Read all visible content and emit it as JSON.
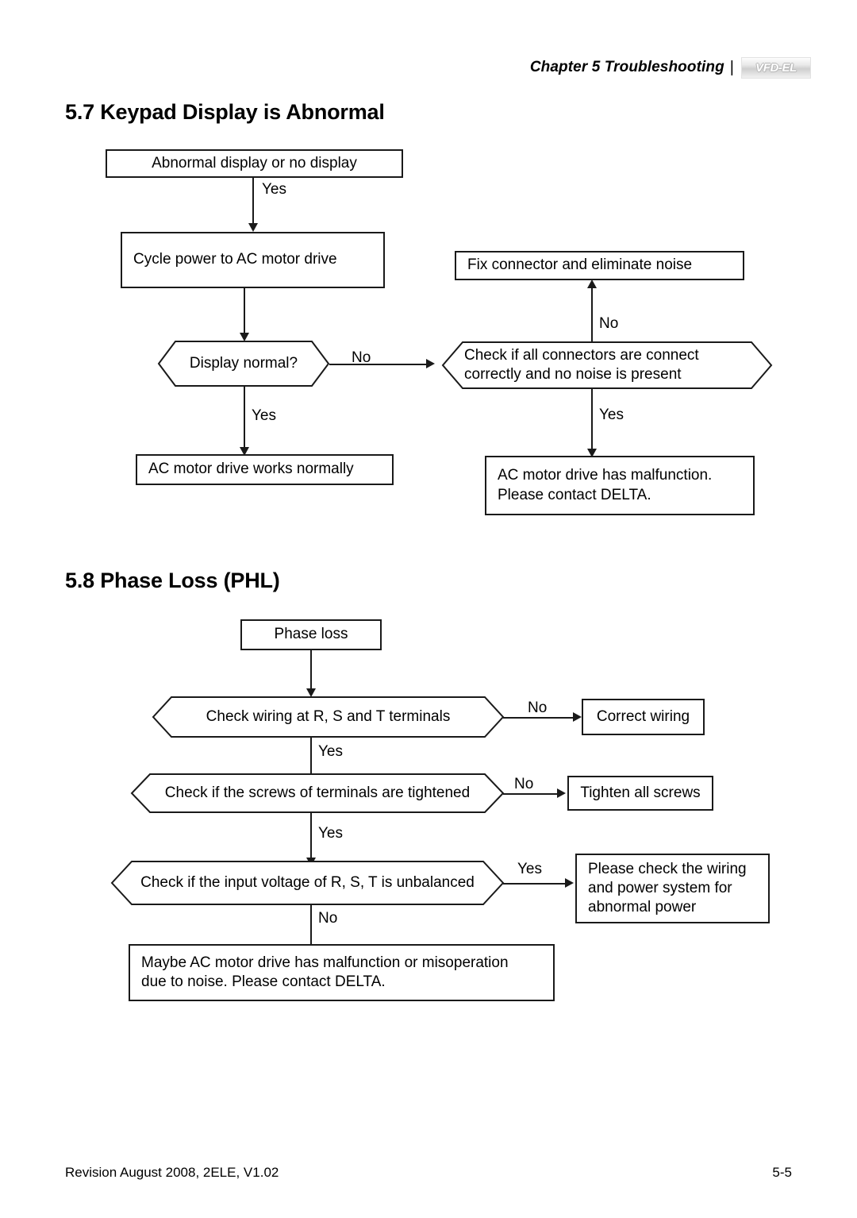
{
  "header": {
    "chapter_title": "Chapter 5 Troubleshooting",
    "separator": "|",
    "brand_logo": "VFD-EL"
  },
  "sections": [
    {
      "heading": "5.7 Keypad Display is Abnormal",
      "nodes": {
        "start": "Abnormal display or no display",
        "cycle_power": "Cycle power to AC motor drive",
        "display_normal": "Display normal?",
        "works_normally": "AC motor drive works normally",
        "check_connectors": "Check if all connectors are connect\ncorrectly and no noise is present",
        "fix_connector": "Fix connector and eliminate noise",
        "has_malfunction": "AC motor drive has malfunction.\nPlease contact DELTA."
      },
      "edge_labels": {
        "start_to_cycle": "Yes",
        "display_no": "No",
        "display_yes": "Yes",
        "connectors_no": "No",
        "connectors_yes": "Yes"
      }
    },
    {
      "heading": "5.8 Phase Loss (PHL)",
      "nodes": {
        "start": "Phase loss",
        "check_wiring": "Check wiring at R, S and T terminals",
        "correct_wiring": "Correct wiring",
        "check_screws": "Check if the screws of terminals are tightened",
        "tighten_screws": "Tighten all screws",
        "check_voltage": "Check if the input voltage of R, S, T is unbalanced",
        "please_check": "Please check the wiring\nand power system for\nabnormal power",
        "maybe_malfunction": "Maybe AC motor drive has malfunction or misoperation\ndue to noise. Please contact DELTA."
      },
      "edge_labels": {
        "wiring_no": "No",
        "wiring_yes": "Yes",
        "screws_no": "No",
        "screws_yes": "Yes",
        "voltage_yes": "Yes",
        "voltage_no": "No"
      }
    }
  ],
  "footer": {
    "revision": "Revision August 2008, 2ELE, V1.02",
    "page_number": "5-5"
  },
  "colors": {
    "ink": "#000000",
    "stroke": "#1a1a1a",
    "paper": "#ffffff",
    "logo_silver": "#cfcfcf"
  }
}
